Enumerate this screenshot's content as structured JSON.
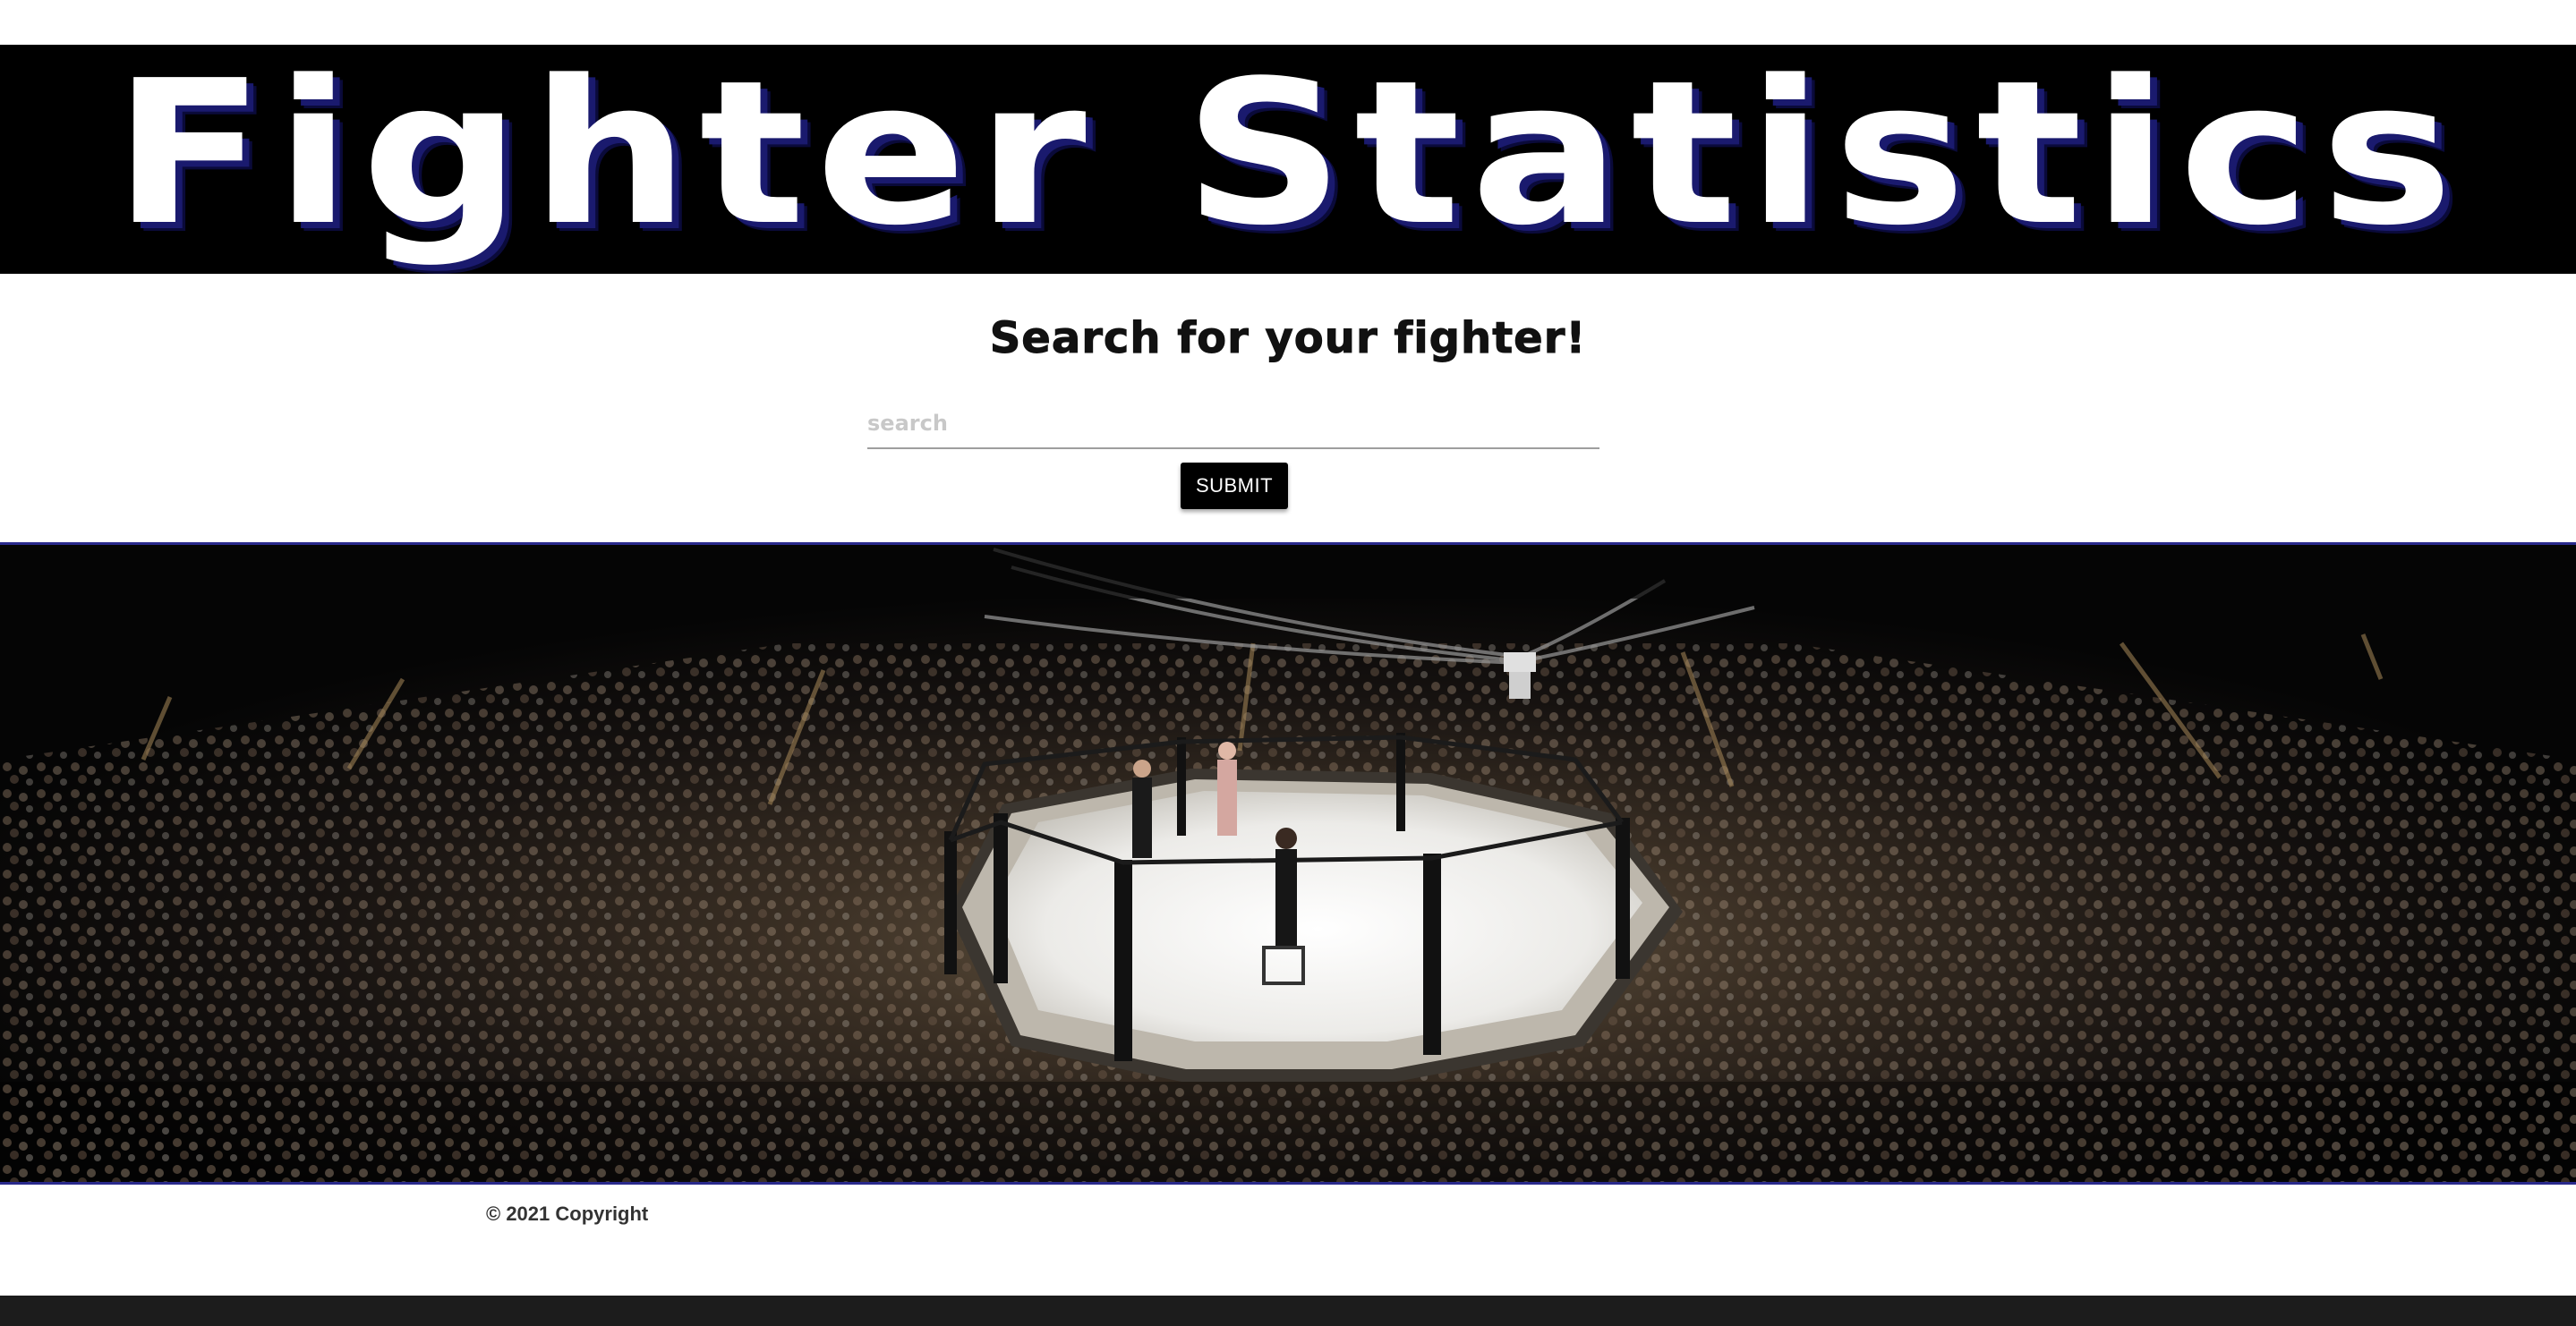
{
  "header": {
    "title": "Fighter Statistics"
  },
  "search": {
    "heading": "Search for your fighter!",
    "placeholder": "search",
    "value": "",
    "submit_label": "SUBMIT"
  },
  "hero": {
    "image_subject": "octagon-arena-photo"
  },
  "footer": {
    "copyright": "© 2021 Copyright"
  },
  "colors": {
    "header_bg": "#000000",
    "title_shadow": "#1a1a6e",
    "accent_border": "#2a2a8c",
    "button_bg": "#000000",
    "bottom_bar": "#1c1c1c"
  }
}
